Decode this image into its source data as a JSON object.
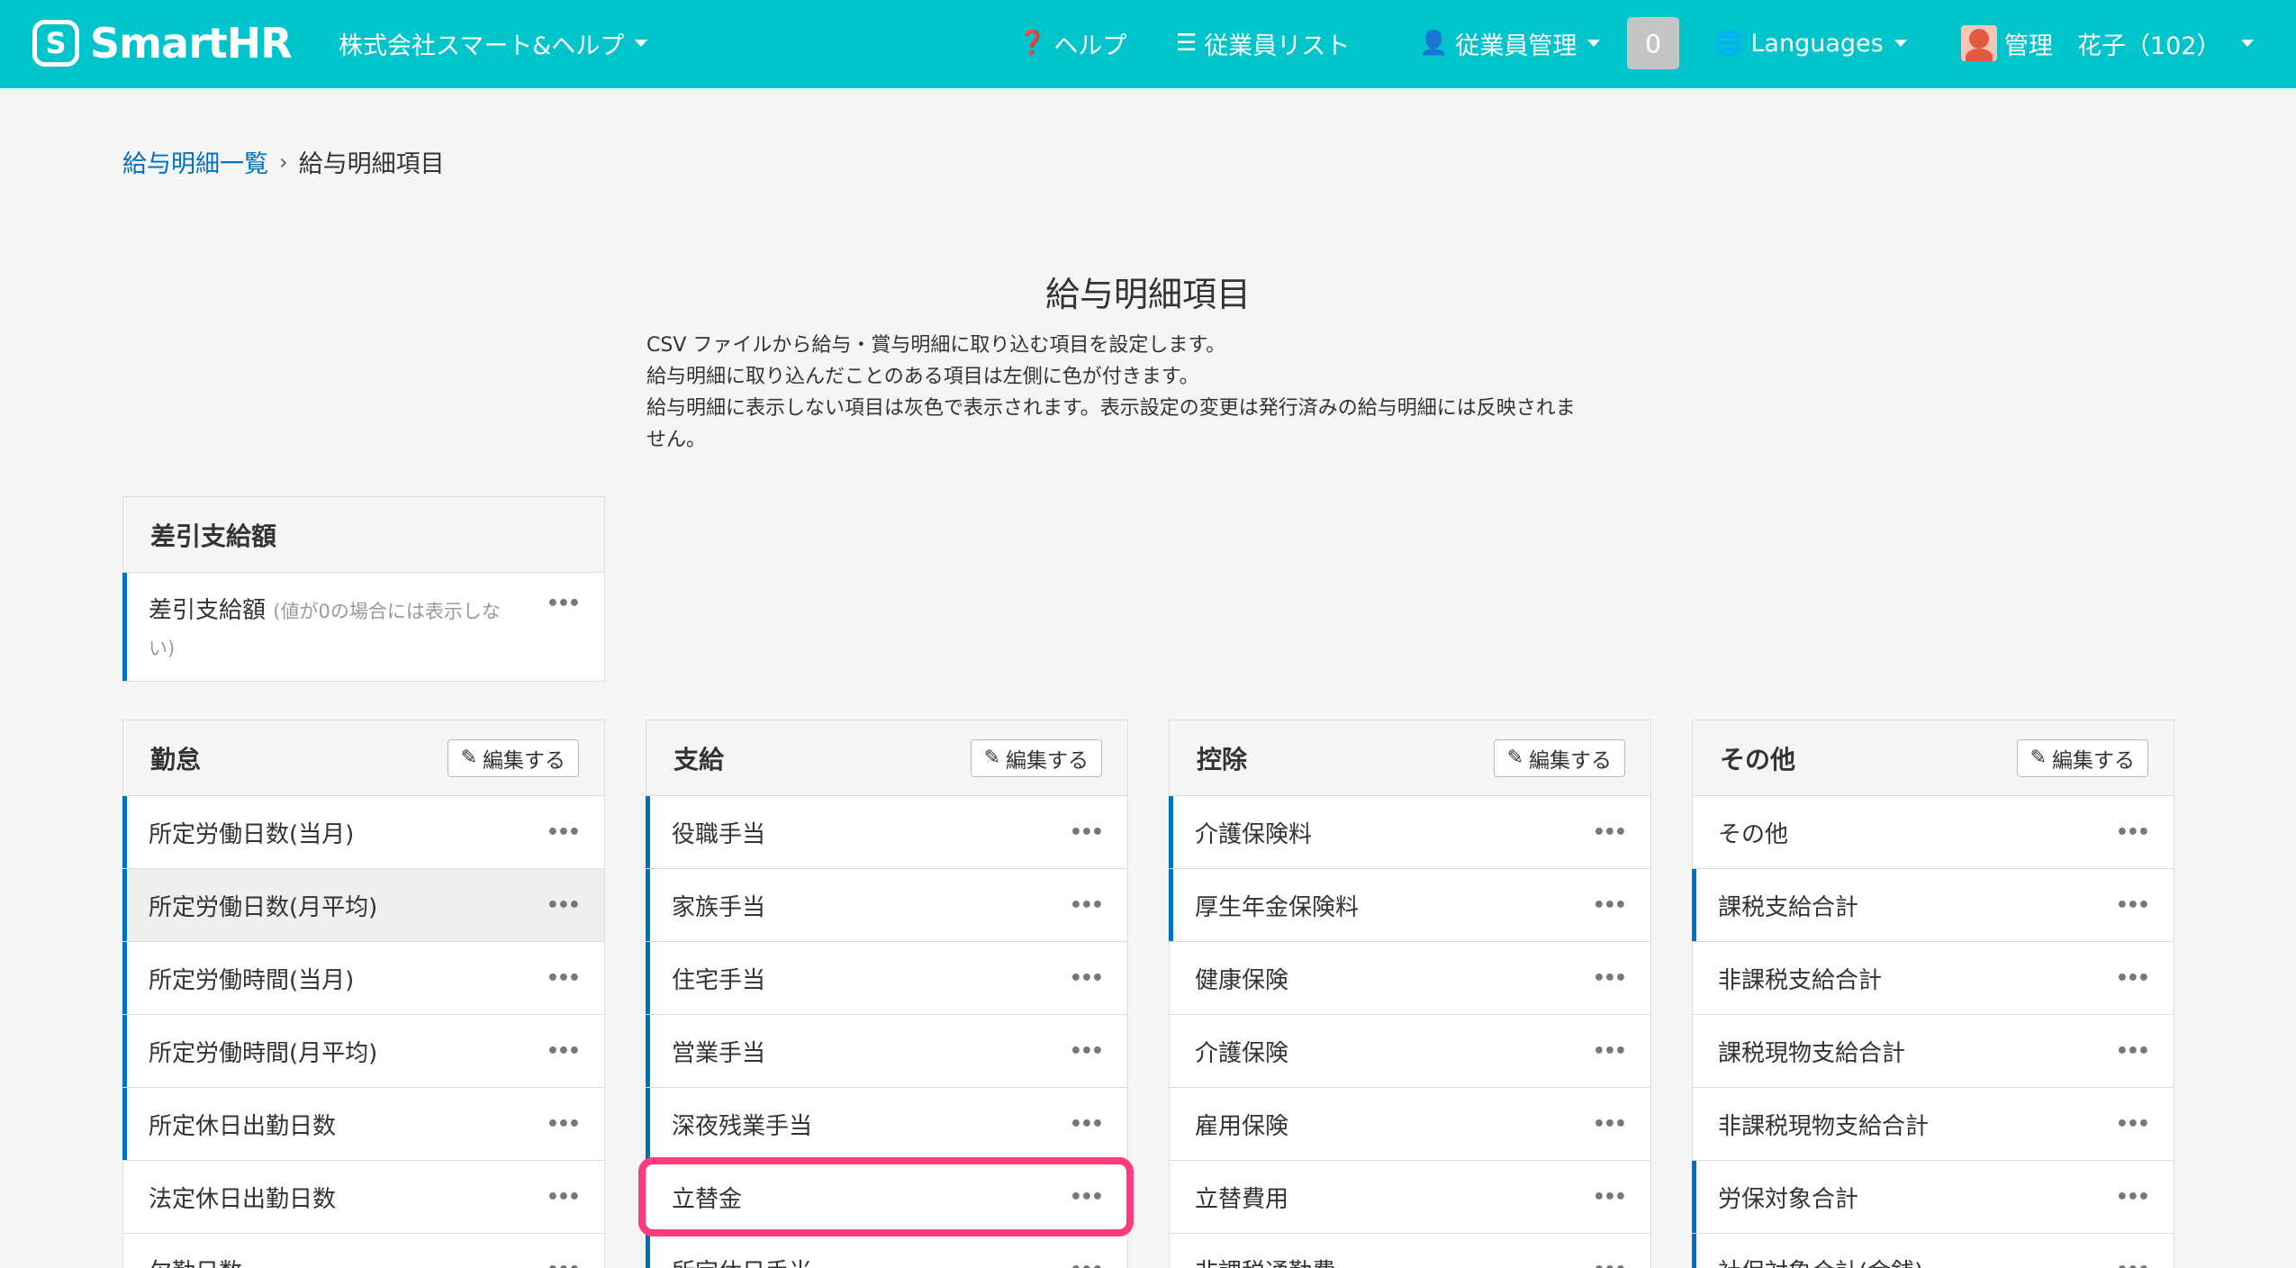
{
  "header": {
    "logo_mark": "S",
    "logo_text": "SmartHR",
    "company": "株式会社スマート&ヘルプ",
    "help": "ヘルプ",
    "employee_list": "従業員リスト",
    "employee_mgmt": "従業員管理",
    "notification_count": "0",
    "languages": "Languages",
    "user": "管理　花子（102）"
  },
  "breadcrumb": {
    "parent": "給与明細一覧",
    "separator": "›",
    "current": "給与明細項目"
  },
  "page": {
    "title": "給与明細項目",
    "desc1": "CSV ファイルから給与・賞与明細に取り込む項目を設定します。",
    "desc2": "給与明細に取り込んだことのある項目は左側に色が付きます。",
    "desc3": "給与明細に表示しない項目は灰色で表示されます。表示設定の変更は発行済みの給与明細には反映されま",
    "desc4": "せん。"
  },
  "sashihiki": {
    "title": "差引支給額",
    "item_label": "差引支給額",
    "item_note": "(値が0の場合には表示しない)"
  },
  "edit_label": "編集する",
  "panels": {
    "kintai": {
      "title": "勤怠",
      "items": [
        "所定労働日数(当月)",
        "所定労働日数(月平均)",
        "所定労働時間(当月)",
        "所定労働時間(月平均)",
        "所定休日出勤日数",
        "法定休日出勤日数",
        "欠勤日数"
      ]
    },
    "shikyu": {
      "title": "支給",
      "items": [
        "役職手当",
        "家族手当",
        "住宅手当",
        "営業手当",
        "深夜残業手当",
        "立替金",
        "所定休日手当"
      ]
    },
    "kojo": {
      "title": "控除",
      "items": [
        "介護保険料",
        "厚生年金保険料",
        "健康保険",
        "介護保険",
        "雇用保険",
        "立替費用",
        "非課税通勤費"
      ]
    },
    "sonota": {
      "title": "その他",
      "items": [
        "その他",
        "課税支給合計",
        "非課税支給合計",
        "課税現物支給合計",
        "非課税現物支給合計",
        "労保対象合計",
        "社保対象合計(金銭)"
      ]
    }
  },
  "colors": {
    "header": "#00c4cc",
    "accent": "#0071c1",
    "highlight": "#ff3d7a"
  }
}
